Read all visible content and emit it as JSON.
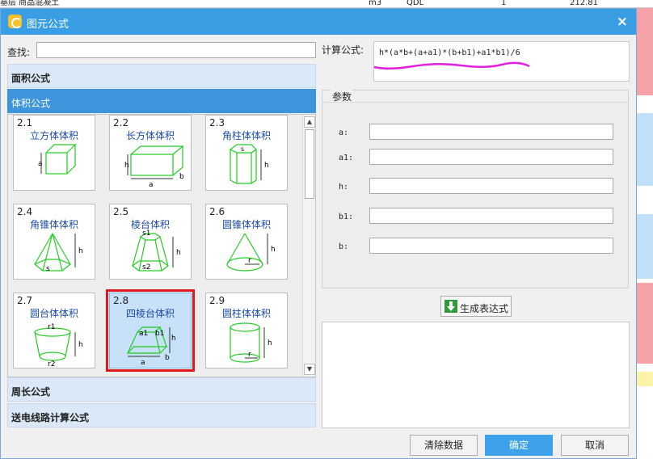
{
  "background": {
    "row_cells": [
      "基层 商品混凝土",
      "m3",
      "QDL",
      "1",
      "212.81"
    ]
  },
  "dialog": {
    "title": "图元公式",
    "close_label": "×",
    "search_label": "查找:",
    "search_value": "",
    "categories": [
      {
        "label": "面积公式"
      },
      {
        "label": "体积公式"
      },
      {
        "label": "周长公式"
      },
      {
        "label": "送电线路计算公式"
      }
    ],
    "tiles": [
      {
        "num": "2.1",
        "name": "立方体体积",
        "labels": [
          "a"
        ]
      },
      {
        "num": "2.2",
        "name": "长方体体积",
        "labels": [
          "h",
          "a",
          "b"
        ]
      },
      {
        "num": "2.3",
        "name": "角柱体体积",
        "labels": [
          "s",
          "h"
        ]
      },
      {
        "num": "2.4",
        "name": "角锥体体积",
        "labels": [
          "h",
          "s"
        ]
      },
      {
        "num": "2.5",
        "name": "棱台体积",
        "labels": [
          "s1",
          "h",
          "s2"
        ]
      },
      {
        "num": "2.6",
        "name": "圆锥体体积",
        "labels": [
          "h",
          "r"
        ]
      },
      {
        "num": "2.7",
        "name": "圆台体体积",
        "labels": [
          "r1",
          "h",
          "r2"
        ]
      },
      {
        "num": "2.8",
        "name": "四棱台体积",
        "labels": [
          "a1",
          "b1",
          "h",
          "a",
          "b"
        ]
      },
      {
        "num": "2.9",
        "name": "圆柱体体积",
        "labels": [
          "h",
          "r"
        ]
      }
    ],
    "formula_label": "计算公式:",
    "formula_value": "h*(a*b+(a+a1)*(b+b1)+a1*b1)/6",
    "params_title": "参数",
    "params": [
      {
        "label": "a:",
        "value": ""
      },
      {
        "label": "a1:",
        "value": ""
      },
      {
        "label": "h:",
        "value": ""
      },
      {
        "label": "b1:",
        "value": ""
      },
      {
        "label": "b:",
        "value": ""
      }
    ],
    "generate_label": "生成表达式",
    "result_value": "",
    "buttons": {
      "clear": "清除数据",
      "ok": "确定",
      "cancel": "取消"
    }
  },
  "colors": {
    "accent": "#3a9ee4",
    "selection_border": "#e0181c",
    "annotation": "#e020e0",
    "shape_stroke": "#22cc22"
  }
}
